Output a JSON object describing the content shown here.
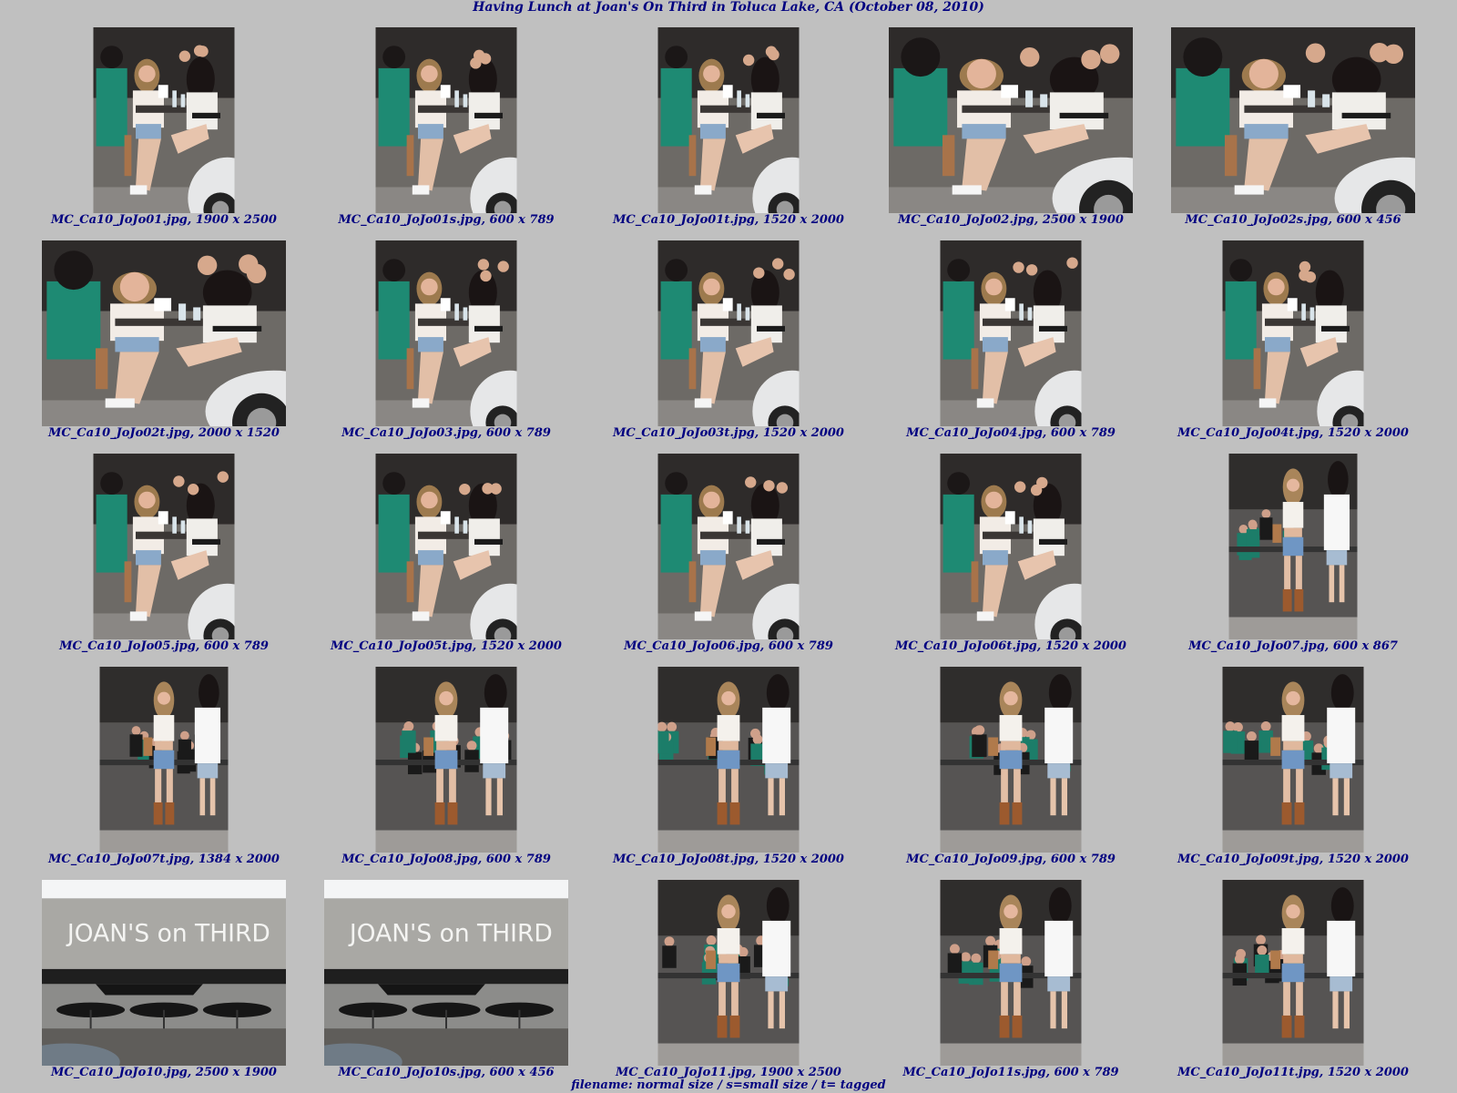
{
  "page": {
    "title": "Having Lunch at Joan's On Third in Toluca Lake, CA (October 08, 2010)",
    "legend": "filename: normal size / s=small size / t= tagged"
  },
  "images": [
    {
      "caption": "MC_Ca10_JoJo01.jpg, 1900 x 2500",
      "scene": "cafe"
    },
    {
      "caption": "MC_Ca10_JoJo01s.jpg, 600 x 789",
      "scene": "cafe"
    },
    {
      "caption": "MC_Ca10_JoJo01t.jpg, 1520 x 2000",
      "scene": "cafe"
    },
    {
      "caption": "MC_Ca10_JoJo02.jpg, 2500 x 1900",
      "scene": "cafe-wide"
    },
    {
      "caption": "MC_Ca10_JoJo02s.jpg, 600 x 456",
      "scene": "cafe-wide"
    },
    {
      "caption": "MC_Ca10_JoJo02t.jpg, 2000 x 1520",
      "scene": "cafe-wide"
    },
    {
      "caption": "MC_Ca10_JoJo03.jpg, 600 x 789",
      "scene": "cafe"
    },
    {
      "caption": "MC_Ca10_JoJo03t.jpg, 1520 x 2000",
      "scene": "cafe"
    },
    {
      "caption": "MC_Ca10_JoJo04.jpg, 600 x 789",
      "scene": "cafe"
    },
    {
      "caption": "MC_Ca10_JoJo04t.jpg, 1520 x 2000",
      "scene": "cafe"
    },
    {
      "caption": "MC_Ca10_JoJo05.jpg, 600 x 789",
      "scene": "cafe"
    },
    {
      "caption": "MC_Ca10_JoJo05t.jpg, 1520 x 2000",
      "scene": "cafe"
    },
    {
      "caption": "MC_Ca10_JoJo06.jpg, 600 x 789",
      "scene": "cafe"
    },
    {
      "caption": "MC_Ca10_JoJo06t.jpg, 1520 x 2000",
      "scene": "cafe"
    },
    {
      "caption": "MC_Ca10_JoJo07.jpg, 600 x 867",
      "scene": "street"
    },
    {
      "caption": "MC_Ca10_JoJo07t.jpg, 1384 x 2000",
      "scene": "street"
    },
    {
      "caption": "MC_Ca10_JoJo08.jpg, 600 x 789",
      "scene": "street"
    },
    {
      "caption": "MC_Ca10_JoJo08t.jpg, 1520 x 2000",
      "scene": "street"
    },
    {
      "caption": "MC_Ca10_JoJo09.jpg, 600 x 789",
      "scene": "street"
    },
    {
      "caption": "MC_Ca10_JoJo09t.jpg, 1520 x 2000",
      "scene": "street"
    },
    {
      "caption": "MC_Ca10_JoJo10.jpg, 2500 x 1900",
      "scene": "storefront",
      "sign": "JOAN'S on THIRD"
    },
    {
      "caption": "MC_Ca10_JoJo10s.jpg, 600 x 456",
      "scene": "storefront",
      "sign": "JOAN'S on THIRD"
    },
    {
      "caption": "MC_Ca10_JoJo11.jpg, 1900 x 2500",
      "scene": "street"
    },
    {
      "caption": "MC_Ca10_JoJo11s.jpg, 600 x 789",
      "scene": "street"
    },
    {
      "caption": "MC_Ca10_JoJo11t.jpg, 1520 x 2000",
      "scene": "street"
    }
  ]
}
